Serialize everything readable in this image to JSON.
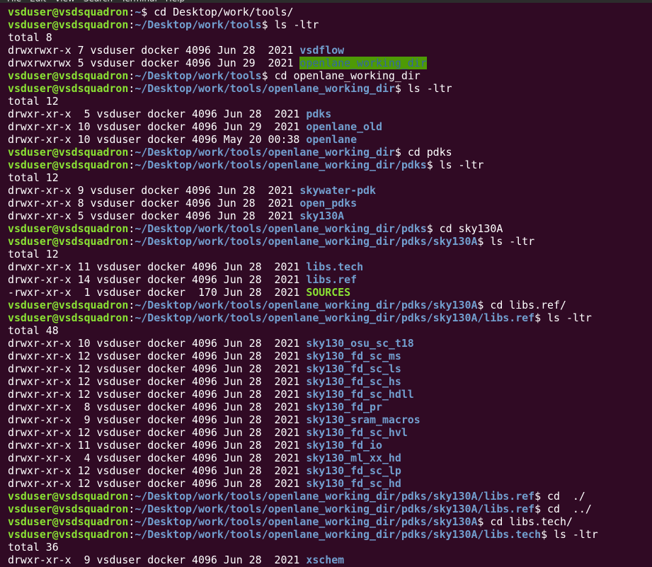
{
  "menubar": {
    "items": [
      "File",
      "Edit",
      "View",
      "Search",
      "Terminal",
      "Help"
    ]
  },
  "prompt": {
    "user_host": "vsduser@vsdsquadron"
  },
  "lines": [
    {
      "type": "prompt",
      "path": "~",
      "cmd": "cd Desktop/work/tools/"
    },
    {
      "type": "prompt",
      "path": "~/Desktop/work/tools",
      "cmd": "ls -ltr"
    },
    {
      "type": "text",
      "text": "total 8"
    },
    {
      "type": "entry",
      "meta": "drwxrwxr-x 7 vsduser docker 4096 Jun 28  2021 ",
      "name": "vsdflow",
      "style": "dir"
    },
    {
      "type": "entry",
      "meta": "drwxrwxrwx 5 vsduser docker 4096 Jun 29  2021 ",
      "name": "openlane_working_dir",
      "style": "dir-otherwritable"
    },
    {
      "type": "prompt",
      "path": "~/Desktop/work/tools",
      "cmd": "cd openlane_working_dir"
    },
    {
      "type": "prompt",
      "path": "~/Desktop/work/tools/openlane_working_dir",
      "cmd": "ls -ltr"
    },
    {
      "type": "text",
      "text": "total 12"
    },
    {
      "type": "entry",
      "meta": "drwxr-xr-x  5 vsduser docker 4096 Jun 28  2021 ",
      "name": "pdks",
      "style": "dir"
    },
    {
      "type": "entry",
      "meta": "drwxr-xr-x 10 vsduser docker 4096 Jun 29  2021 ",
      "name": "openlane_old",
      "style": "dir"
    },
    {
      "type": "entry",
      "meta": "drwxr-xr-x 10 vsduser docker 4096 May 20 00:38 ",
      "name": "openlane",
      "style": "dir"
    },
    {
      "type": "prompt",
      "path": "~/Desktop/work/tools/openlane_working_dir",
      "cmd": "cd pdks"
    },
    {
      "type": "prompt",
      "path": "~/Desktop/work/tools/openlane_working_dir/pdks",
      "cmd": "ls -ltr"
    },
    {
      "type": "text",
      "text": "total 12"
    },
    {
      "type": "entry",
      "meta": "drwxr-xr-x 9 vsduser docker 4096 Jun 28  2021 ",
      "name": "skywater-pdk",
      "style": "dir"
    },
    {
      "type": "entry",
      "meta": "drwxr-xr-x 8 vsduser docker 4096 Jun 28  2021 ",
      "name": "open_pdks",
      "style": "dir"
    },
    {
      "type": "entry",
      "meta": "drwxr-xr-x 5 vsduser docker 4096 Jun 28  2021 ",
      "name": "sky130A",
      "style": "dir"
    },
    {
      "type": "prompt",
      "path": "~/Desktop/work/tools/openlane_working_dir/pdks",
      "cmd": "cd sky130A"
    },
    {
      "type": "prompt",
      "path": "~/Desktop/work/tools/openlane_working_dir/pdks/sky130A",
      "cmd": "ls -ltr"
    },
    {
      "type": "text",
      "text": "total 12"
    },
    {
      "type": "entry",
      "meta": "drwxr-xr-x 11 vsduser docker 4096 Jun 28  2021 ",
      "name": "libs.tech",
      "style": "dir"
    },
    {
      "type": "entry",
      "meta": "drwxr-xr-x 14 vsduser docker 4096 Jun 28  2021 ",
      "name": "libs.ref",
      "style": "dir"
    },
    {
      "type": "entry",
      "meta": "-rwxr-xr-x  1 vsduser docker  170 Jun 28  2021 ",
      "name": "SOURCES",
      "style": "exec"
    },
    {
      "type": "prompt",
      "path": "~/Desktop/work/tools/openlane_working_dir/pdks/sky130A",
      "cmd": "cd libs.ref/"
    },
    {
      "type": "prompt",
      "path": "~/Desktop/work/tools/openlane_working_dir/pdks/sky130A/libs.ref",
      "cmd": "ls -ltr"
    },
    {
      "type": "text",
      "text": "total 48"
    },
    {
      "type": "entry",
      "meta": "drwxr-xr-x 10 vsduser docker 4096 Jun 28  2021 ",
      "name": "sky130_osu_sc_t18",
      "style": "dir"
    },
    {
      "type": "entry",
      "meta": "drwxr-xr-x 12 vsduser docker 4096 Jun 28  2021 ",
      "name": "sky130_fd_sc_ms",
      "style": "dir"
    },
    {
      "type": "entry",
      "meta": "drwxr-xr-x 12 vsduser docker 4096 Jun 28  2021 ",
      "name": "sky130_fd_sc_ls",
      "style": "dir"
    },
    {
      "type": "entry",
      "meta": "drwxr-xr-x 12 vsduser docker 4096 Jun 28  2021 ",
      "name": "sky130_fd_sc_hs",
      "style": "dir"
    },
    {
      "type": "entry",
      "meta": "drwxr-xr-x 12 vsduser docker 4096 Jun 28  2021 ",
      "name": "sky130_fd_sc_hdll",
      "style": "dir"
    },
    {
      "type": "entry",
      "meta": "drwxr-xr-x  8 vsduser docker 4096 Jun 28  2021 ",
      "name": "sky130_fd_pr",
      "style": "dir"
    },
    {
      "type": "entry",
      "meta": "drwxr-xr-x  9 vsduser docker 4096 Jun 28  2021 ",
      "name": "sky130_sram_macros",
      "style": "dir"
    },
    {
      "type": "entry",
      "meta": "drwxr-xr-x 12 vsduser docker 4096 Jun 28  2021 ",
      "name": "sky130_fd_sc_hvl",
      "style": "dir"
    },
    {
      "type": "entry",
      "meta": "drwxr-xr-x 11 vsduser docker 4096 Jun 28  2021 ",
      "name": "sky130_fd_io",
      "style": "dir"
    },
    {
      "type": "entry",
      "meta": "drwxr-xr-x  4 vsduser docker 4096 Jun 28  2021 ",
      "name": "sky130_ml_xx_hd",
      "style": "dir"
    },
    {
      "type": "entry",
      "meta": "drwxr-xr-x 12 vsduser docker 4096 Jun 28  2021 ",
      "name": "sky130_fd_sc_lp",
      "style": "dir"
    },
    {
      "type": "entry",
      "meta": "drwxr-xr-x 12 vsduser docker 4096 Jun 28  2021 ",
      "name": "sky130_fd_sc_hd",
      "style": "dir"
    },
    {
      "type": "prompt",
      "path": "~/Desktop/work/tools/openlane_working_dir/pdks/sky130A/libs.ref",
      "cmd": "cd  ./"
    },
    {
      "type": "prompt",
      "path": "~/Desktop/work/tools/openlane_working_dir/pdks/sky130A/libs.ref",
      "cmd": "cd  ../"
    },
    {
      "type": "prompt",
      "path": "~/Desktop/work/tools/openlane_working_dir/pdks/sky130A",
      "cmd": "cd libs.tech/"
    },
    {
      "type": "prompt",
      "path": "~/Desktop/work/tools/openlane_working_dir/pdks/sky130A/libs.tech",
      "cmd": "ls -ltr"
    },
    {
      "type": "text",
      "text": "total 36"
    },
    {
      "type": "entry",
      "meta": "drwxr-xr-x  9 vsduser docker 4096 Jun 28  2021 ",
      "name": "xschem",
      "style": "dir"
    }
  ]
}
